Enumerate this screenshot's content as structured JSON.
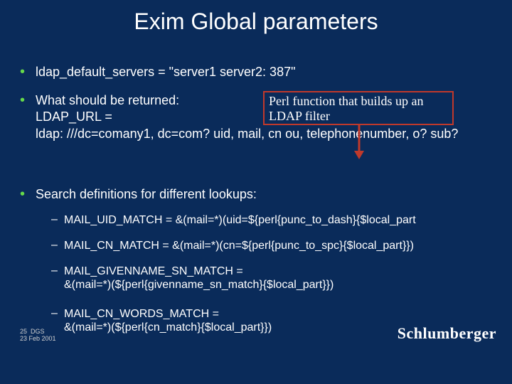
{
  "title": "Exim Global parameters",
  "bullets": [
    "ldap_default_servers = \"server1 server2: 387\"",
    "What should be returned:\nLDAP_URL =\nldap: ///dc=comany1, dc=com? uid, mail, cn ou, telephonenumber, o? sub?",
    "Search definitions for different lookups:"
  ],
  "subs": [
    "MAIL_UID_MATCH = &(mail=*)(uid=${perl{punc_to_dash}{$local_part",
    "MAIL_CN_MATCH   = &(mail=*)(cn=${perl{punc_to_spc}{$local_part}})",
    "MAIL_GIVENNAME_SN_MATCH    =\n&(mail=*)(${perl{givenname_sn_match}{$local_part}})",
    "MAIL_CN_WORDS_MATCH    =\n&(mail=*)(${perl{cn_match}{$local_part}})"
  ],
  "callout": "Perl function that builds up an LDAP  filter",
  "footer": {
    "page": "25",
    "label": "DGS",
    "date": "23 Feb 2001"
  },
  "brand": "Schlumberger"
}
